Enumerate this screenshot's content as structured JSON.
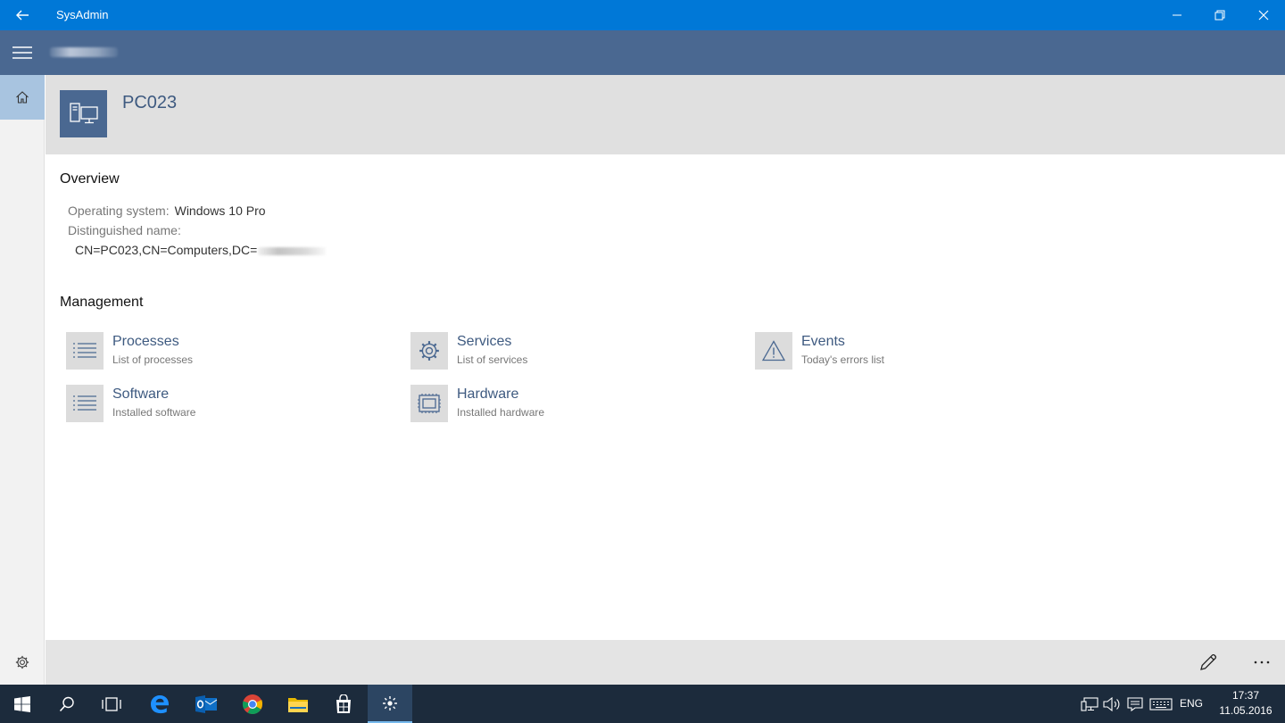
{
  "window": {
    "title": "SysAdmin",
    "icons": [
      "back-icon",
      "minimize-icon",
      "restore-icon",
      "close-icon"
    ]
  },
  "appbar": {
    "menu_icon": "hamburger-icon"
  },
  "nav": {
    "home_icon": "home-icon",
    "settings_icon": "gear-icon"
  },
  "computer": {
    "name": "PC023",
    "icon": "computer-icon"
  },
  "overview": {
    "heading": "Overview",
    "os_label": "Operating system:",
    "os_value": "Windows 10 Pro",
    "dn_label": "Distinguished name:",
    "dn_value": "CN=PC023,CN=Computers,DC="
  },
  "management": {
    "heading": "Management",
    "items": [
      {
        "title": "Processes",
        "subtitle": "List of processes",
        "icon": "list-icon"
      },
      {
        "title": "Services",
        "subtitle": "List of services",
        "icon": "gear-icon"
      },
      {
        "title": "Events",
        "subtitle": "Today's errors list",
        "icon": "warning-icon"
      },
      {
        "title": "Software",
        "subtitle": "Installed software",
        "icon": "list-icon"
      },
      {
        "title": "Hardware",
        "subtitle": "Installed hardware",
        "icon": "chip-icon"
      }
    ]
  },
  "commandbar": {
    "edit_icon": "pencil-icon",
    "more_icon": "more-icon"
  },
  "taskbar": {
    "apps": [
      "windows-start-icon",
      "search-icon",
      "task-view-icon",
      "edge-icon",
      "outlook-icon",
      "chrome-icon",
      "file-explorer-icon",
      "store-icon",
      "sysadmin-app-icon"
    ],
    "language": "ENG",
    "time": "17:37",
    "date": "11.05.2016"
  },
  "colors": {
    "titlebar": "#0078d7",
    "appbar": "#4a6891",
    "accent_text": "#3e5a80",
    "taskbar": "#1c2b3c"
  }
}
